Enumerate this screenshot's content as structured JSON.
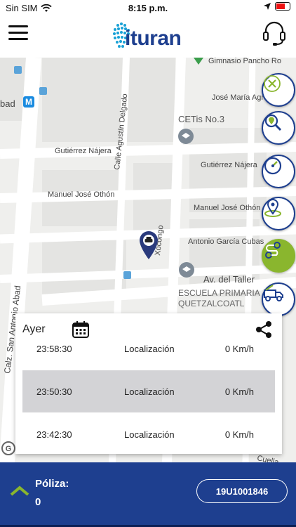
{
  "status_bar": {
    "carrier": "Sin SIM",
    "time": "8:15 p.m."
  },
  "header": {
    "logo_text": "ituran"
  },
  "map": {
    "labels": [
      "Gimnasio Pancho Ro",
      "José María Agreda",
      "bad",
      "CETis No.3",
      "Gutiérrez Nájera",
      "Gutiérrez Nájera",
      "Calle Agustín Delgado",
      "Manuel José Othón",
      "Manuel José Othón",
      "Calz. San Antonio Abad",
      "Xocongo",
      "Antonio García Cubas",
      "Av. del Taller",
      "ESCUELA PRIMARIA",
      "QUETZALCOATL",
      "Cuella"
    ]
  },
  "side_buttons": [
    "close",
    "location-search",
    "speedometer",
    "geofence",
    "route",
    "tow-truck"
  ],
  "history": {
    "title": "Ayer",
    "rows": [
      {
        "time": "23:58:30",
        "event": "Localización",
        "speed": "0 Km/h"
      },
      {
        "time": "23:50:30",
        "event": "Localización",
        "speed": "0 Km/h"
      },
      {
        "time": "23:42:30",
        "event": "Localización",
        "speed": "0 Km/h"
      }
    ]
  },
  "footer": {
    "policy_label": "Póliza:",
    "policy_value": "0",
    "plate": "19U1001846"
  },
  "colors": {
    "brand_blue": "#1e3f8f",
    "accent_green": "#8ab62e"
  }
}
